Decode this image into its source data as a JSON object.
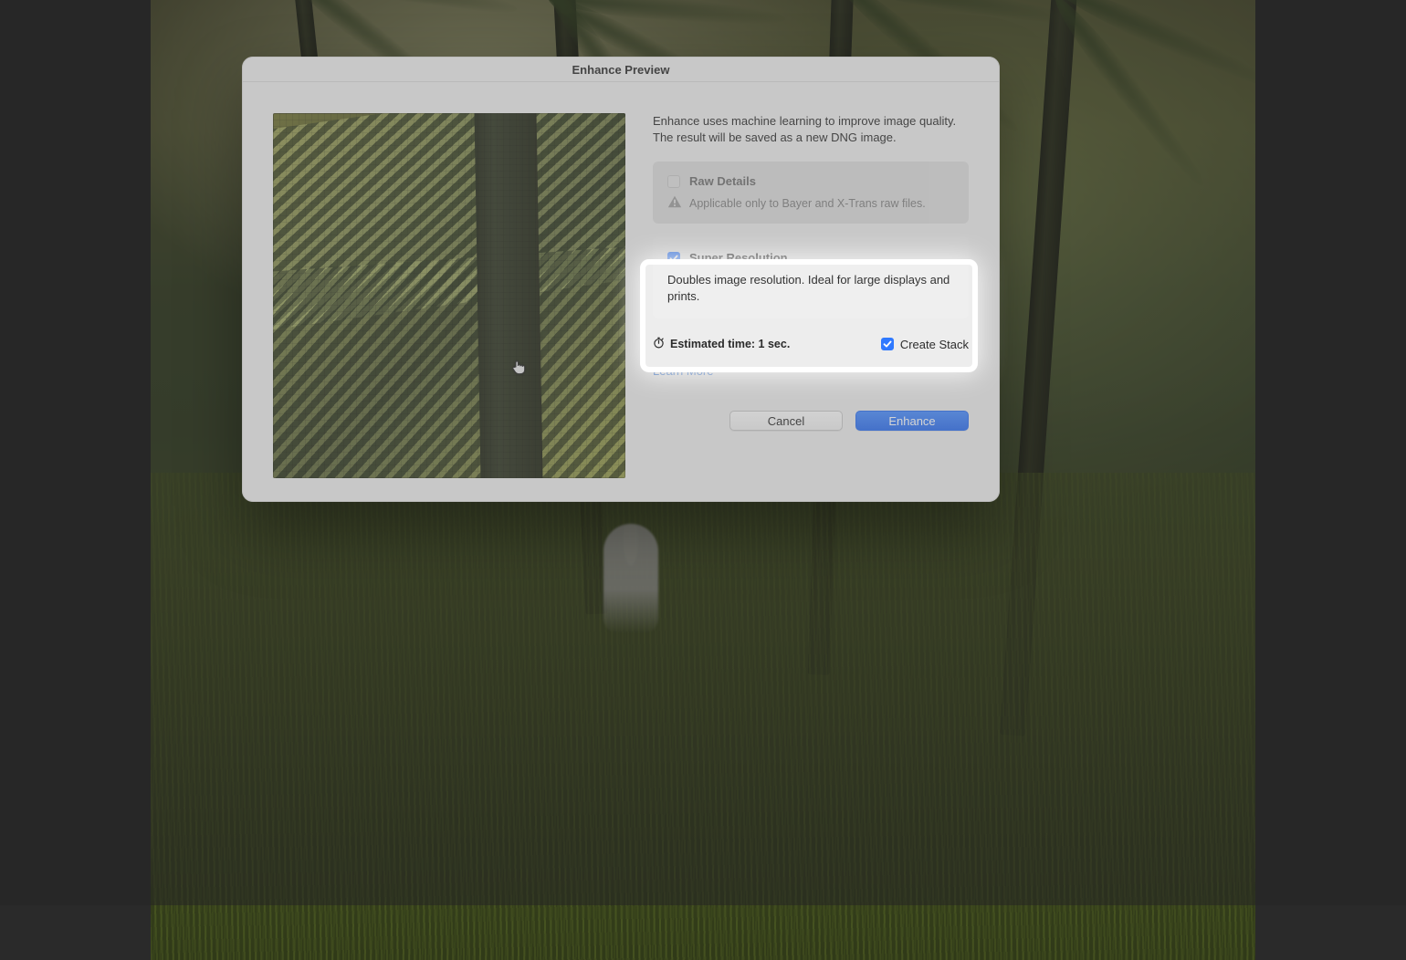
{
  "dialog": {
    "title": "Enhance Preview",
    "intro": "Enhance uses machine learning to improve image quality. The result will be saved as a new DNG image.",
    "raw_details": {
      "label": "Raw Details",
      "checked": false,
      "enabled": false,
      "note": "Applicable only to Bayer and X-Trans raw files."
    },
    "super_resolution": {
      "label": "Super Resolution",
      "checked": true,
      "description": "Doubles image resolution. Ideal for large displays and prints."
    },
    "estimated_time_label": "Estimated time: 1 sec.",
    "create_stack": {
      "label": "Create Stack",
      "checked": true
    },
    "learn_more": "Learn More",
    "buttons": {
      "cancel": "Cancel",
      "enhance": "Enhance"
    }
  },
  "icons": {
    "warning": "warning-icon",
    "stopwatch": "stopwatch-icon",
    "hand": "hand-cursor-icon",
    "check": "check-icon"
  },
  "colors": {
    "accent_blue": "#2f79ff",
    "link_blue": "#2f6fd0",
    "dialog_bg": "#ededed",
    "panel_bg": "#dcdcdc"
  }
}
